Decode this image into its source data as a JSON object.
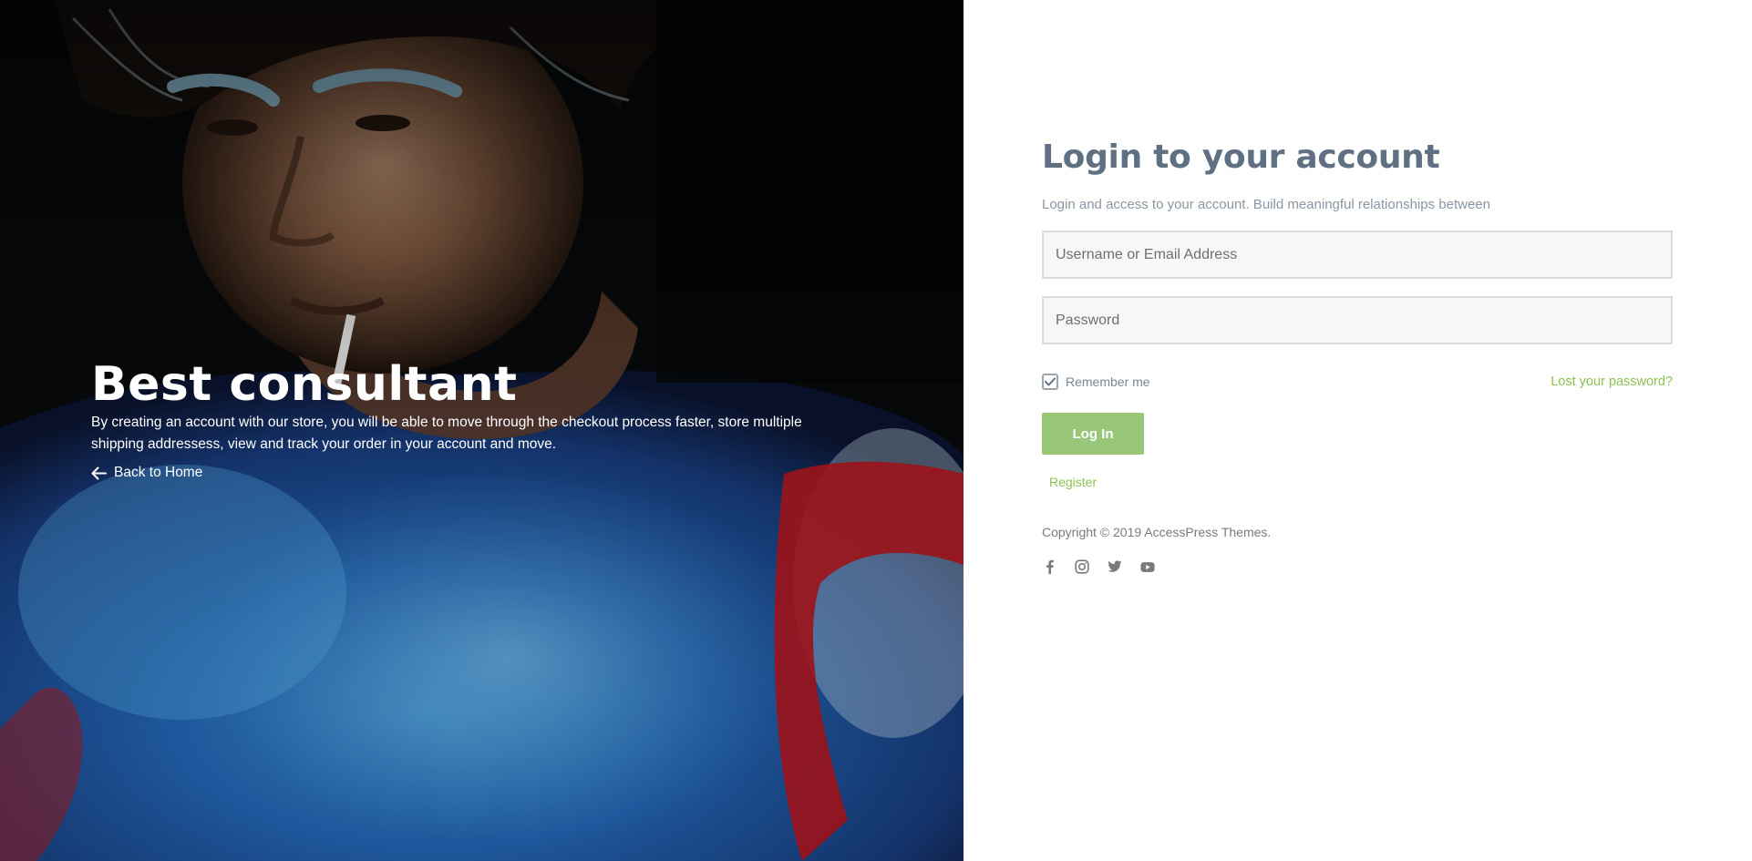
{
  "hero": {
    "title": "Best consultant",
    "description": "By creating an account with our store, you will be able to move through the checkout process faster, store multiple shipping addressess, view and track your order in your account and move.",
    "back_link": "Back to Home",
    "back_icon": "arrow-left-icon"
  },
  "login": {
    "title": "Login to your account",
    "subtitle": "Login and access to your account. Build meaningful relationships between",
    "username_placeholder": "Username or Email Address",
    "username_value": "",
    "password_placeholder": "Password",
    "password_value": "",
    "remember_label": "Remember me",
    "remember_checked": true,
    "lost_password": "Lost your password?",
    "submit_label": "Log In",
    "register_label": "Register"
  },
  "footer": {
    "copyright": "Copyright © 2019 AccessPress Themes.",
    "social": [
      "facebook-icon",
      "instagram-icon",
      "twitter-icon",
      "youtube-icon"
    ]
  },
  "colors": {
    "accent": "#8cc152",
    "button": "#98c77a",
    "heading": "#5e7082",
    "text_muted": "#8a96a3"
  }
}
